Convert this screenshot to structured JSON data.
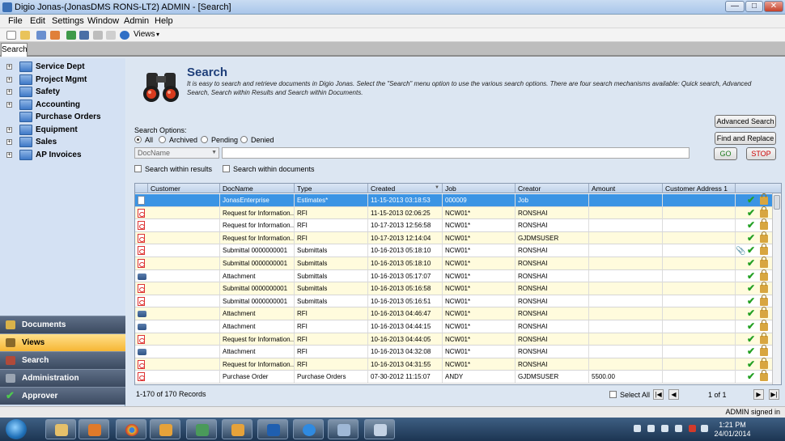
{
  "window": {
    "title": "Digio Jonas-(JonasDMS RONS-LT2) ADMIN - [Search]",
    "min": "—",
    "max": "□",
    "close": "✕"
  },
  "menu": [
    "File",
    "Edit",
    "Settings",
    "Window",
    "Admin",
    "Help"
  ],
  "toolbar": {
    "views_label": "Views",
    "views_arrow": "▾"
  },
  "tabs": [
    "Search"
  ],
  "tree": [
    {
      "label": "Service Dept"
    },
    {
      "label": "Project Mgmt"
    },
    {
      "label": "Safety"
    },
    {
      "label": "Accounting"
    },
    {
      "label": "Purchase Orders"
    },
    {
      "label": "Equipment"
    },
    {
      "label": "Sales"
    },
    {
      "label": "AP Invoices"
    }
  ],
  "nav": [
    {
      "label": "Documents",
      "active": false
    },
    {
      "label": "Views",
      "active": true
    },
    {
      "label": "Search",
      "active": false
    },
    {
      "label": "Administration",
      "active": false
    },
    {
      "label": "Approver",
      "active": false
    }
  ],
  "search": {
    "title": "Search",
    "description": "It is easy to search and retrieve documents in Digio Jonas. Select the \"Search\" menu option to use the various search options. There are four search mechanisms available: Quick search, Advanced Search, Search within Results and Search within Documents.",
    "advanced_button": "Advanced Search",
    "find_replace_button": "Find and Replace",
    "options_label": "Search Options:",
    "options": [
      {
        "label": "All",
        "selected": true
      },
      {
        "label": "Archived",
        "selected": false
      },
      {
        "label": "Pending",
        "selected": false
      },
      {
        "label": "Denied",
        "selected": false
      }
    ],
    "field_select": "DocName",
    "query": "",
    "go_button": "GO",
    "stop_button": "STOP",
    "within_results": "Search within results",
    "within_documents": "Search within documents"
  },
  "grid": {
    "columns": [
      "Customer",
      "DocName",
      "Type",
      "Created",
      "Job",
      "Creator",
      "Amount",
      "Customer Address 1"
    ],
    "rows": [
      {
        "icon": "doc",
        "customer": "",
        "docname": "JonasEnterprise",
        "type": "Estimates*",
        "created": "11-15-2013 03:18:53",
        "job": "000009",
        "creator": "Job",
        "amount": "",
        "address": "",
        "clip": false
      },
      {
        "icon": "pdf",
        "customer": "",
        "docname": "Request for Information...",
        "type": "RFI",
        "created": "11-15-2013 02:06:25",
        "job": "NCW01*",
        "creator": "RONSHAI",
        "amount": "",
        "address": "",
        "clip": false
      },
      {
        "icon": "pdf",
        "customer": "",
        "docname": "Request for Information...",
        "type": "RFI",
        "created": "10-17-2013 12:56:58",
        "job": "NCW01*",
        "creator": "RONSHAI",
        "amount": "",
        "address": "",
        "clip": false
      },
      {
        "icon": "pdf",
        "customer": "",
        "docname": "Request for Information...",
        "type": "RFI",
        "created": "10-17-2013 12:14:04",
        "job": "NCW01*",
        "creator": "GJDMSUSER",
        "amount": "",
        "address": "",
        "clip": false
      },
      {
        "icon": "pdf",
        "customer": "",
        "docname": "Submittal 0000000001",
        "type": "Submittals",
        "created": "10-16-2013 05:18:10",
        "job": "NCW01*",
        "creator": "RONSHAI",
        "amount": "",
        "address": "",
        "clip": true
      },
      {
        "icon": "pdf",
        "customer": "",
        "docname": "Submittal 0000000001",
        "type": "Submittals",
        "created": "10-16-2013 05:18:10",
        "job": "NCW01*",
        "creator": "RONSHAI",
        "amount": "",
        "address": "",
        "clip": false
      },
      {
        "icon": "att",
        "customer": "",
        "docname": "Attachment",
        "type": "Submittals",
        "created": "10-16-2013 05:17:07",
        "job": "NCW01*",
        "creator": "RONSHAI",
        "amount": "",
        "address": "",
        "clip": false
      },
      {
        "icon": "pdf",
        "customer": "",
        "docname": "Submittal 0000000001",
        "type": "Submittals",
        "created": "10-16-2013 05:16:58",
        "job": "NCW01*",
        "creator": "RONSHAI",
        "amount": "",
        "address": "",
        "clip": false
      },
      {
        "icon": "pdf",
        "customer": "",
        "docname": "Submittal 0000000001",
        "type": "Submittals",
        "created": "10-16-2013 05:16:51",
        "job": "NCW01*",
        "creator": "RONSHAI",
        "amount": "",
        "address": "",
        "clip": false
      },
      {
        "icon": "att",
        "customer": "",
        "docname": "Attachment",
        "type": "RFI",
        "created": "10-16-2013 04:46:47",
        "job": "NCW01*",
        "creator": "RONSHAI",
        "amount": "",
        "address": "",
        "clip": false
      },
      {
        "icon": "att",
        "customer": "",
        "docname": "Attachment",
        "type": "RFI",
        "created": "10-16-2013 04:44:15",
        "job": "NCW01*",
        "creator": "RONSHAI",
        "amount": "",
        "address": "",
        "clip": false
      },
      {
        "icon": "pdf",
        "customer": "",
        "docname": "Request for Information...",
        "type": "RFI",
        "created": "10-16-2013 04:44:05",
        "job": "NCW01*",
        "creator": "RONSHAI",
        "amount": "",
        "address": "",
        "clip": false
      },
      {
        "icon": "att",
        "customer": "",
        "docname": "Attachment",
        "type": "RFI",
        "created": "10-16-2013 04:32:08",
        "job": "NCW01*",
        "creator": "RONSHAI",
        "amount": "",
        "address": "",
        "clip": false
      },
      {
        "icon": "pdf",
        "customer": "",
        "docname": "Request for Information...",
        "type": "RFI",
        "created": "10-16-2013 04:31:55",
        "job": "NCW01*",
        "creator": "RONSHAI",
        "amount": "",
        "address": "",
        "clip": false
      },
      {
        "icon": "pdf",
        "customer": "",
        "docname": "Purchase Order",
        "type": "Purchase Orders",
        "created": "07-30-2012 11:15:07",
        "job": "ANDY",
        "creator": "GJDMSUSER",
        "amount": "5500.00",
        "address": "",
        "clip": false
      }
    ],
    "record_count": "1-170 of 170 Records",
    "select_all": "Select All",
    "page": "1 of 1"
  },
  "status": {
    "signed_in": "ADMIN signed in"
  },
  "clock": {
    "time": "1:21 PM",
    "date": "24/01/2014"
  },
  "colors": {
    "selected_row": "#3b94e4",
    "alt_row": "#fffbdd",
    "stop_text": "#cc0000",
    "go_text": "#1d7a1d",
    "title_blue": "#1f3f7a"
  }
}
